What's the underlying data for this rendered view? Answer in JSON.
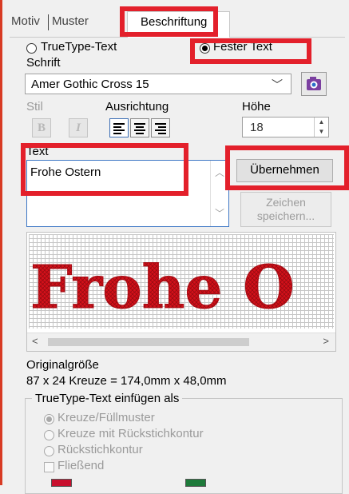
{
  "tabs": [
    {
      "label": "Motiv"
    },
    {
      "label": "Muster"
    },
    {
      "label": "Beschriftung",
      "active": true
    }
  ],
  "text_type": {
    "truetype_label": "TrueType-Text",
    "fixed_label": "Fester Text",
    "selected": "Fester Text"
  },
  "font": {
    "section_label": "Schrift",
    "selected": "Amer Gothic Cross 15",
    "camera_icon": "camera-icon"
  },
  "style": {
    "label": "Stil",
    "bold": "B",
    "italic": "I"
  },
  "alignment": {
    "label": "Ausrichtung",
    "selected": "left",
    "options": [
      "left",
      "center",
      "right"
    ]
  },
  "height": {
    "label": "Höhe",
    "value": "18"
  },
  "text": {
    "label": "Text",
    "value": "Frohe Ostern"
  },
  "buttons": {
    "apply": "Übernehmen",
    "save_chars_line1": "Zeichen",
    "save_chars_line2": "speichern..."
  },
  "preview": {
    "visible_text": "Frohe O",
    "stitch_color": "#d4101a",
    "scroll_left": "<",
    "scroll_right": ">"
  },
  "info": {
    "label": "Originalgröße",
    "size": "87 x 24 Kreuze = 174,0mm x 48,0mm"
  },
  "insert_group": {
    "title": "TrueType-Text einfügen als",
    "options": [
      {
        "label": "Kreuze/Füllmuster",
        "selected": true
      },
      {
        "label": "Kreuze mit Rückstichkontur",
        "selected": false
      },
      {
        "label": "Rückstichkontur",
        "selected": false
      }
    ],
    "flowing_label": "Fließend"
  },
  "colors": {
    "accent_red": "#e3202b",
    "swatch_1": "#c8102e",
    "swatch_2": "#1e7a3a"
  }
}
